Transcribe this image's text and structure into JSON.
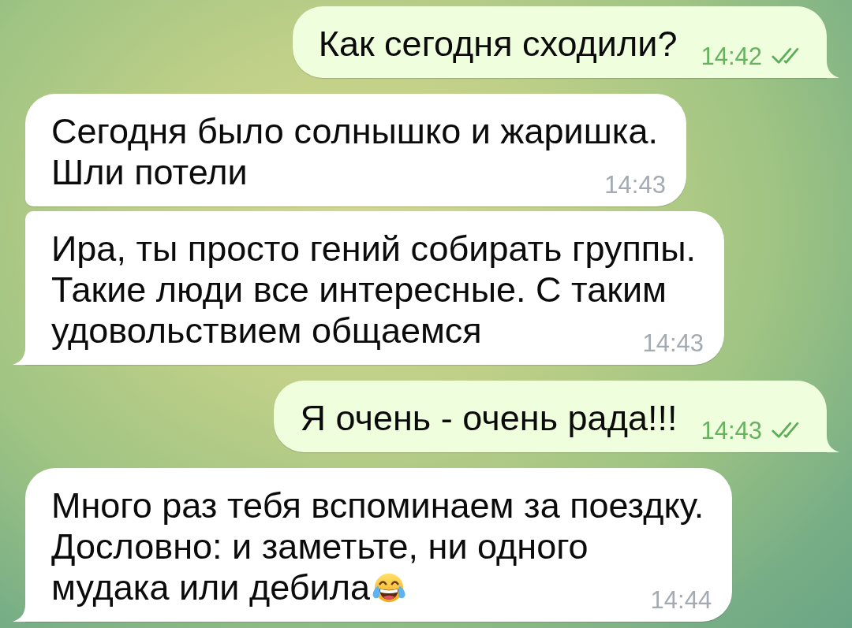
{
  "messages": [
    {
      "kind": "outgoing",
      "lines": [
        "Как сегодня сходили?"
      ],
      "time": "14:42",
      "read": true,
      "tail": true
    },
    {
      "kind": "incoming",
      "lines": [
        "Сегодня было солнышко и жаришка.",
        "Шли потели"
      ],
      "time": "14:43",
      "tail": false
    },
    {
      "kind": "incoming",
      "lines": [
        "Ира, ты просто гений собирать группы.",
        "Такие люди все интересные. С таким",
        "удовольствием общаемся"
      ],
      "time": "14:43",
      "tail": true
    },
    {
      "kind": "outgoing",
      "lines": [
        "Я очень - очень рада!!!"
      ],
      "time": "14:43",
      "read": true,
      "tail": true
    },
    {
      "kind": "incoming",
      "lines": [
        "Много раз тебя вспоминаем за поездку.",
        "Дословно: и заметьте, ни одного",
        "мудака или дебила"
      ],
      "time": "14:44",
      "tail": true,
      "trailing_emoji": true
    }
  ]
}
